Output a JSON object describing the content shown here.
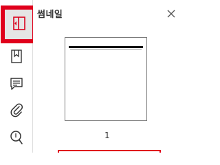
{
  "sidebar": {
    "items": [
      {
        "icon": "panel-toggle-icon",
        "active": true
      },
      {
        "icon": "bookmark-icon"
      },
      {
        "icon": "comment-icon"
      },
      {
        "icon": "paperclip-icon"
      },
      {
        "icon": "search-icon"
      }
    ]
  },
  "panel": {
    "title": "썸네일",
    "close_icon": "close-icon",
    "page_label": "1"
  },
  "colors": {
    "highlight": "#e0001b",
    "active_bg": "#e5e5e5",
    "icon": "#333333"
  }
}
